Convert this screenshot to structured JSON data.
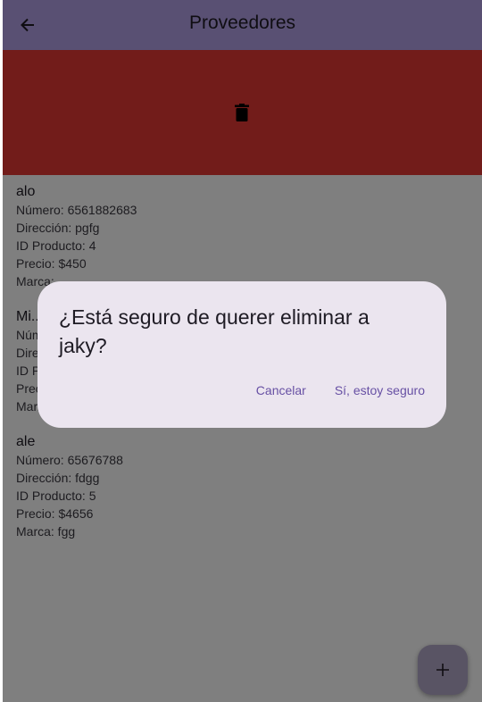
{
  "appbar": {
    "title": "Proveedores",
    "back_icon": "arrow-back-icon"
  },
  "dismiss": {
    "icon": "delete-icon",
    "color": "#e53935"
  },
  "proveedores": [
    {
      "name": "alo",
      "numero": "Número: 6561882683",
      "direccion": "Dirección: pgfg",
      "id_producto": "ID Producto: 4",
      "precio": "Precio: $450",
      "marca": "Marca: ..."
    },
    {
      "name": "Mi...",
      "numero": "Núm...",
      "direccion": "Dire...",
      "id_producto": "ID P...",
      "precio": "Prec...",
      "marca": "Mar..."
    },
    {
      "name": "ale",
      "numero": "Número: 65676788",
      "direccion": "Dirección: fdgg",
      "id_producto": "ID Producto: 5",
      "precio": "Precio: $4656",
      "marca": "Marca: fgg"
    }
  ],
  "dialog": {
    "title": "¿Está seguro de querer eliminar a jaky?",
    "cancel_label": "Cancelar",
    "confirm_label": "Sí, estoy seguro"
  },
  "fab": {
    "icon": "add-icon"
  },
  "colors": {
    "appbar": "#b3a1e6",
    "accent": "#6750a4"
  }
}
